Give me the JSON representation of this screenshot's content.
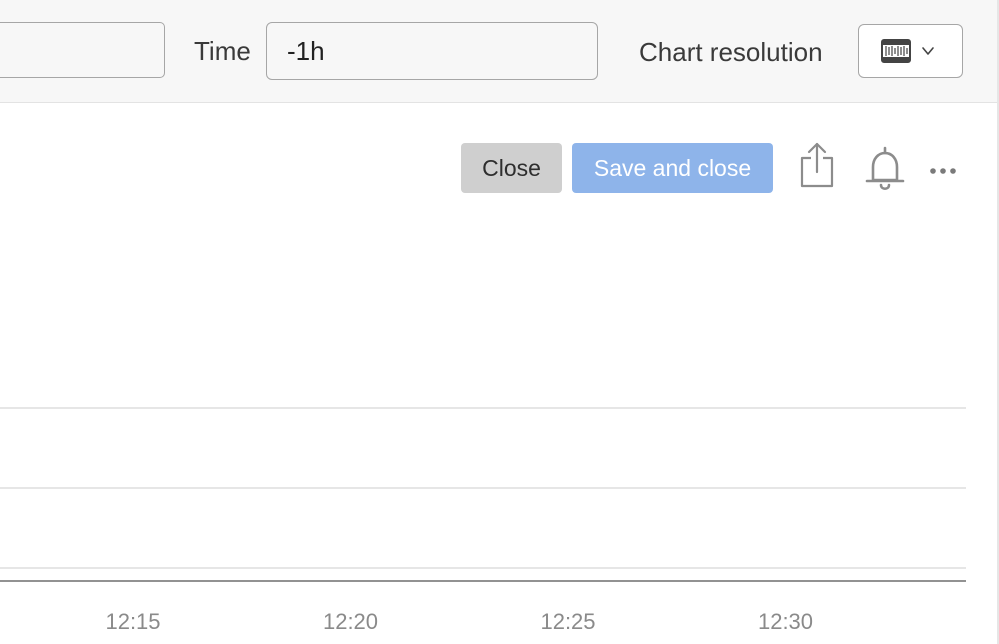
{
  "toolbar": {
    "query_value": "",
    "time_label": "Time",
    "time_value": "-1h",
    "resolution_label": "Chart resolution",
    "resolution_icon": "chart-resolution-icon",
    "dropdown_icon": "chevron-down-icon"
  },
  "actions": {
    "close_label": "Close",
    "save_label": "Save and close",
    "share_icon": "share-icon",
    "alert_icon": "bell-icon",
    "more_icon": "more-horizontal-icon"
  },
  "colors": {
    "save_button_bg": "#8eb4ea",
    "close_button_bg": "#cfcfcf",
    "toolbar_bg": "#f7f7f7",
    "gridline": "#dedede",
    "axis_line": "#6f6f6f",
    "tick_text": "#8a8a8a"
  },
  "chart_data": {
    "type": "line",
    "x_ticks": [
      "12:15",
      "12:20",
      "12:25",
      "12:30"
    ],
    "series": [],
    "grid": true
  }
}
